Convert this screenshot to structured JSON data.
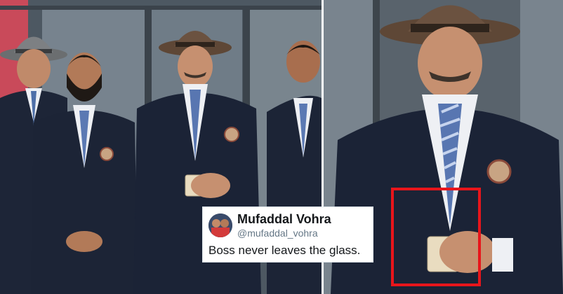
{
  "tweet": {
    "display_name": "Mufaddal Vohra",
    "handle": "@mufaddal_vohra",
    "text": "Boss never leaves the glass."
  },
  "colors": {
    "highlight": "#e8151b",
    "blazer": "#1c2436",
    "tie_stripe": "#6f8fc7",
    "background_wall": "#4a5560"
  }
}
